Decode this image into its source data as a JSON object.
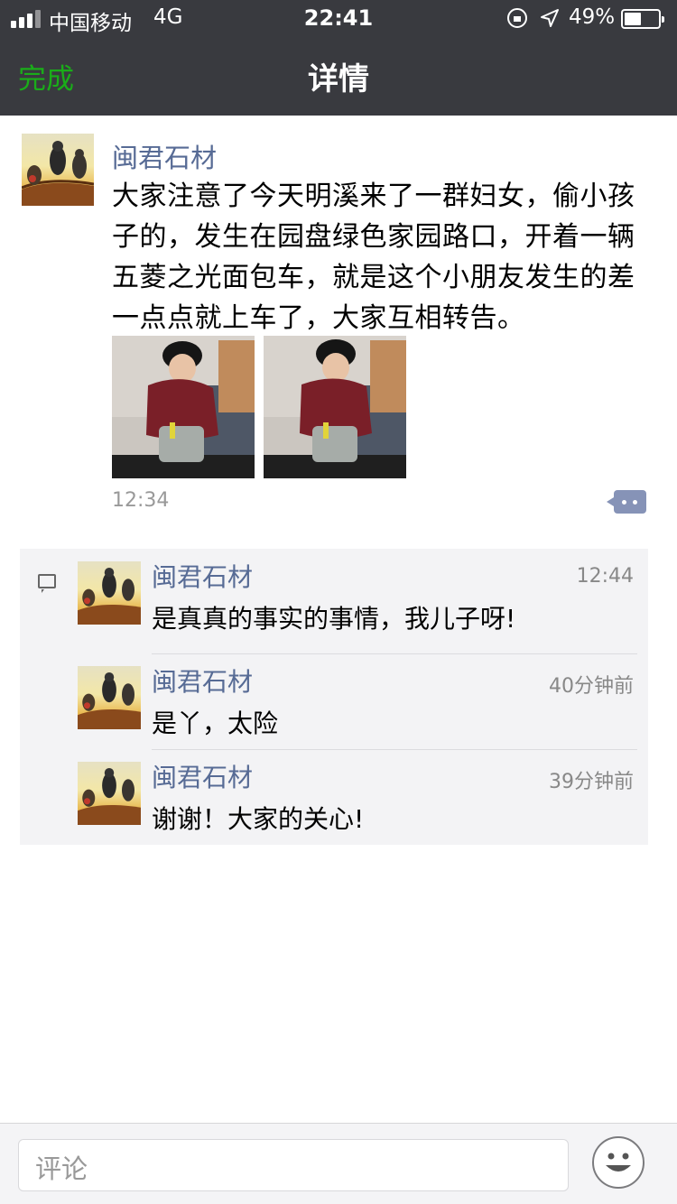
{
  "status_bar": {
    "carrier": "中国移动",
    "network": "4G",
    "time": "22:41",
    "battery_percent": "49%",
    "battery_level": 0.49,
    "icons": [
      "signal-icon",
      "orientation-lock-icon",
      "location-icon",
      "battery-icon"
    ]
  },
  "nav": {
    "done_label": "完成",
    "title": "详情"
  },
  "post": {
    "author": "闽君石材",
    "text": "大家注意了今天明溪来了一群妇女，偷小孩子的，发生在园盘绿色家园路口，开着一辆五菱之光面包车，就是这个小朋友发生的差一点点就上车了，大家互相转告。",
    "time": "12:34",
    "photos": [
      "photo-child-1",
      "photo-child-2"
    ]
  },
  "comments": [
    {
      "author": "闽君石材",
      "time": "12:44",
      "text": "是真真的事实的事情，我儿子呀!"
    },
    {
      "author": "闽君石材",
      "time": "40分钟前",
      "text": "是丫，太险"
    },
    {
      "author": "闽君石材",
      "time": "39分钟前",
      "text": "谢谢！大家的关心!"
    }
  ],
  "input": {
    "placeholder": "评论"
  },
  "colors": {
    "nav_background": "#393a3f",
    "accent_green": "#1aad19",
    "name_blue": "#576b95",
    "comment_panel": "#f3f3f5"
  }
}
